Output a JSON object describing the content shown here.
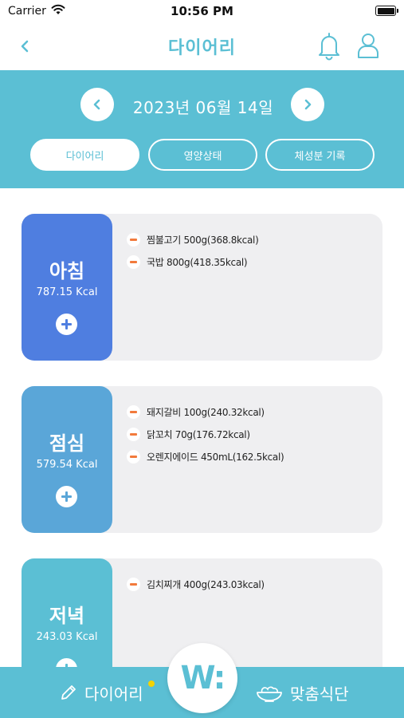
{
  "status_bar": {
    "carrier": "Carrier",
    "time": "10:56 PM"
  },
  "header": {
    "title": "다이어리"
  },
  "date_nav": {
    "date": "2023년 06월 14일"
  },
  "tabs": [
    {
      "label": "다이어리",
      "active": true
    },
    {
      "label": "영양상태",
      "active": false
    },
    {
      "label": "체성분 기록",
      "active": false
    }
  ],
  "meals": {
    "breakfast": {
      "name": "아침",
      "kcal": "787.15 Kcal",
      "items": [
        "찜불고기 500g(368.8kcal)",
        "국밥 800g(418.35kcal)"
      ]
    },
    "lunch": {
      "name": "점심",
      "kcal": "579.54 Kcal",
      "items": [
        "돼지갈비 100g(240.32kcal)",
        "닭꼬치 70g(176.72kcal)",
        "오렌지에이드 450mL(162.5kcal)"
      ]
    },
    "dinner": {
      "name": "저녁",
      "kcal": "243.03 Kcal",
      "items": [
        "김치찌개 400g(243.03kcal)"
      ]
    }
  },
  "bottom_nav": {
    "diary_label": "다이어리",
    "center_logo": "W:",
    "meal_label": "맞춤식단"
  },
  "colors": {
    "accent": "#5bbfd4",
    "breakfast": "#4f7ee0",
    "lunch": "#5aa6d8",
    "dinner": "#5bbfd4",
    "remove": "#f27a3c",
    "notification_dot": "#f5d300"
  },
  "icons": {
    "back": "chevron-left-icon",
    "bell": "bell-icon",
    "user": "user-icon",
    "prev": "chevron-left-icon",
    "next": "chevron-right-icon",
    "add": "plus-icon",
    "remove": "minus-icon",
    "diary": "pencil-icon",
    "meal": "bowl-icon"
  }
}
